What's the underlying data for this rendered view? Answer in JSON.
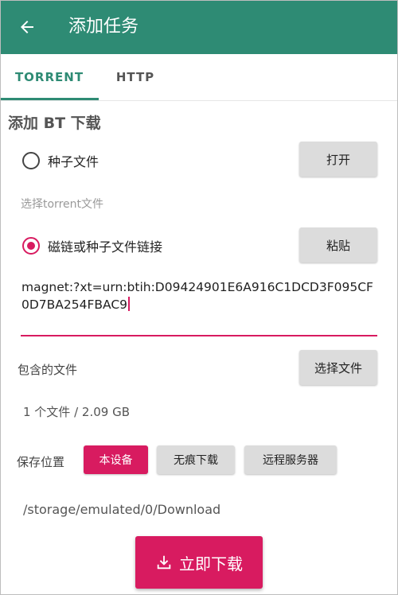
{
  "appbar": {
    "title": "添加任务",
    "back_icon": "arrow-left-icon",
    "color": "#2e8b74"
  },
  "tabs": [
    {
      "label": "TORRENT",
      "active": true
    },
    {
      "label": "HTTP",
      "active": false
    }
  ],
  "bt_section": {
    "title": "添加 BT 下载",
    "option_torrent_file": {
      "label": "种子文件",
      "checked": false,
      "button": "打开"
    },
    "torrent_hint": "选择torrent文件",
    "option_magnet": {
      "label": "磁链或种子文件链接",
      "checked": true,
      "button": "粘贴"
    },
    "magnet_value": "magnet:?xt=urn:btih:D09424901E6A916C1DCD3F095CF0D7BA254FBAC9",
    "accent_color": "#d81b60"
  },
  "files": {
    "label": "包含的文件",
    "button": "选择文件",
    "summary": "1 个文件 / 2.09 GB"
  },
  "save_location": {
    "label": "保存位置",
    "options": [
      {
        "label": "本设备",
        "selected": true
      },
      {
        "label": "无痕下载",
        "selected": false
      },
      {
        "label": "远程服务器",
        "selected": false
      }
    ],
    "path": "/storage/emulated/0/Download"
  },
  "download_button": {
    "label": "立即下载",
    "icon": "download-icon"
  }
}
